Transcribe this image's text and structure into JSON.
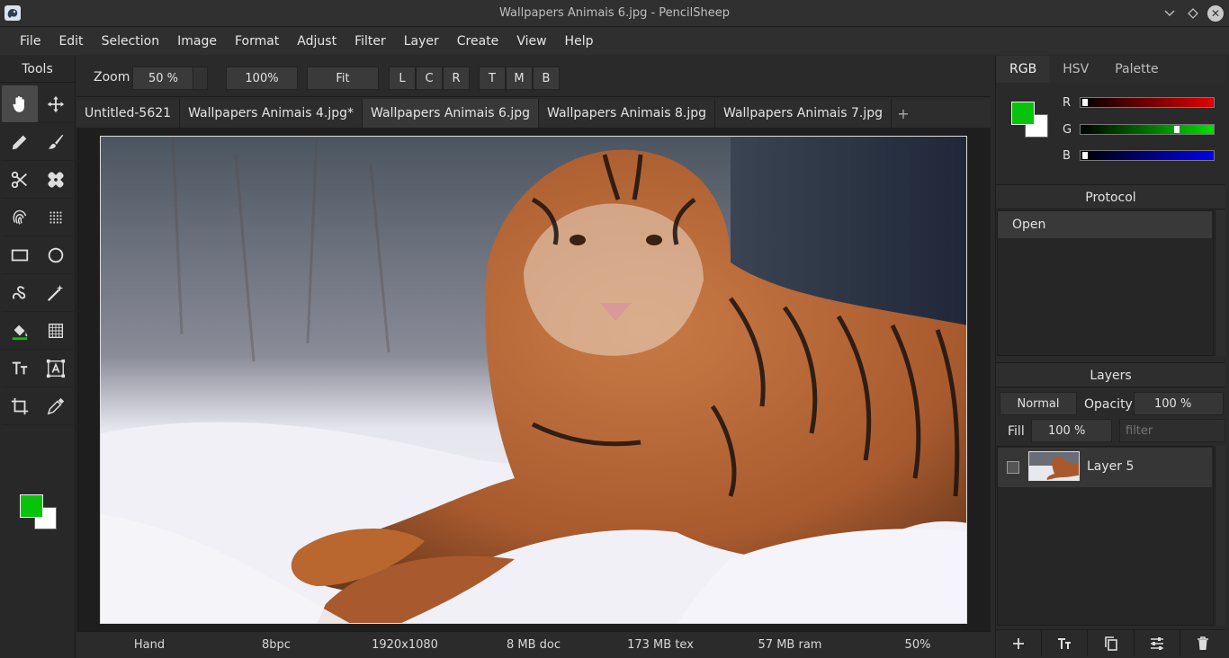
{
  "window": {
    "title": "Wallpapers Animais 6.jpg - PencilSheep"
  },
  "menu": [
    "File",
    "Edit",
    "Selection",
    "Image",
    "Format",
    "Adjust",
    "Filter",
    "Layer",
    "Create",
    "View",
    "Help"
  ],
  "tools": {
    "header": "Tools",
    "items": [
      {
        "icon": "hand-icon",
        "active": true
      },
      {
        "icon": "move-icon"
      },
      {
        "icon": "pencil-icon"
      },
      {
        "icon": "brush-icon"
      },
      {
        "icon": "scissors-icon"
      },
      {
        "icon": "healing-patch-icon"
      },
      {
        "icon": "fingerprint-icon"
      },
      {
        "icon": "noise-dots-icon"
      },
      {
        "icon": "rectangle-icon"
      },
      {
        "icon": "ellipse-icon"
      },
      {
        "icon": "lasso-icon"
      },
      {
        "icon": "magic-wand-icon"
      },
      {
        "icon": "paint-bucket-icon"
      },
      {
        "icon": "gradient-grid-icon"
      },
      {
        "icon": "text-icon"
      },
      {
        "icon": "text-frame-icon"
      },
      {
        "icon": "crop-icon"
      },
      {
        "icon": "eyedropper-icon"
      }
    ]
  },
  "colors": {
    "foreground": "#07c40a",
    "background": "#ffffff"
  },
  "tool_options": {
    "zoom_label": "Zoom",
    "zoom_value": "50 %",
    "btn_100": "100%",
    "btn_fit": "Fit",
    "align_h": [
      "L",
      "C",
      "R"
    ],
    "align_v": [
      "T",
      "M",
      "B"
    ]
  },
  "tabs": [
    {
      "label": "Untitled-5621"
    },
    {
      "label": "Wallpapers Animais 4.jpg*"
    },
    {
      "label": "Wallpapers Animais 6.jpg",
      "active": true
    },
    {
      "label": "Wallpapers Animais 8.jpg"
    },
    {
      "label": "Wallpapers Animais 7.jpg"
    }
  ],
  "tab_add": "+",
  "status": {
    "tool": "Hand",
    "depth": "8bpc",
    "size": "1920x1080",
    "doc": "8 MB doc",
    "tex": "173 MB tex",
    "ram": "57 MB ram",
    "zoom": "50%"
  },
  "color_panel": {
    "tabs": [
      "RGB",
      "HSV",
      "Palette"
    ],
    "channels": [
      {
        "label": "R",
        "value": 0,
        "color": "#e00000"
      },
      {
        "label": "G",
        "value": 0.74,
        "color": "#00e000"
      },
      {
        "label": "B",
        "value": 0,
        "color": "#0000ee"
      }
    ]
  },
  "protocol": {
    "title": "Protocol",
    "items": [
      "Open"
    ]
  },
  "layers": {
    "title": "Layers",
    "blend_mode": "Normal",
    "opacity_label": "Opacity",
    "opacity_value": "100 %",
    "fill_label": "Fill",
    "fill_value": "100 %",
    "filter_placeholder": "filter",
    "items": [
      {
        "name": "Layer 5"
      }
    ],
    "actions": [
      "add-layer-icon",
      "text-layer-icon",
      "duplicate-layer-icon",
      "layer-properties-icon",
      "delete-layer-icon"
    ]
  }
}
